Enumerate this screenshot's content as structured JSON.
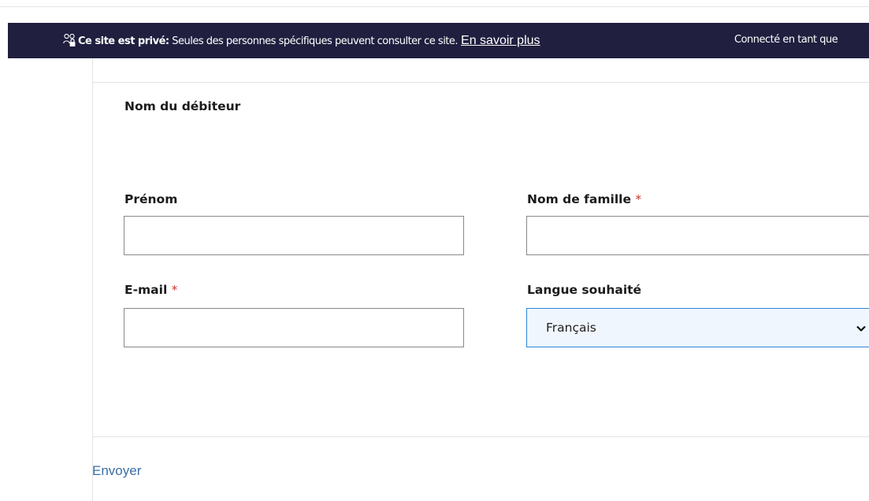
{
  "banner": {
    "icon": "people-lock-icon",
    "title": "Ce site est privé:",
    "message": " Seules des personnes spécifiques peuvent consulter ce site.",
    "learn_more": "En savoir plus",
    "connected": "Connecté en tant que",
    "background": "#201f3f"
  },
  "form": {
    "section_title": "Nom du débiteur",
    "required_marker": "*",
    "first_name": {
      "label": "Prénom",
      "value": ""
    },
    "last_name": {
      "label": "Nom de famille",
      "value": ""
    },
    "email": {
      "label": "E-mail",
      "value": ""
    },
    "language": {
      "label": "Langue souhaité",
      "selected": "Français"
    },
    "submit_label": "Envoyer"
  }
}
